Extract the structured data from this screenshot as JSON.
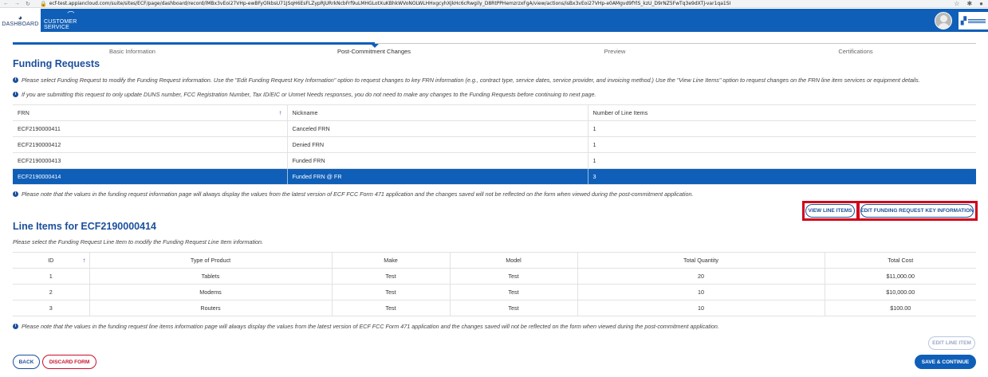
{
  "browser": {
    "url": "ecf-test.appiancloud.com/suite/sites/ECF/page/dashboard/record/lMBx3vEoi27VHp-ewBFyOlkbsU71JSqH6EsFLZypRJURrkNcbFrf9uLMHGLotXuKBhkWVoNOLWLHHxgcyhXJkHc6cRwgily_D8RtPPHemzrzxFgA/view/actions/isBx3vEoi27VHp-e0AMgvd9fYlS_kzU_D9rNZ5FwTq3e9dXTJ-var1qa1SI"
  },
  "header": {
    "tabs": [
      {
        "label": "DASHBOARD",
        "icon": "dashboard-gauge-icon"
      },
      {
        "label": "CUSTOMER SERVICE",
        "icon": "headset-icon"
      }
    ]
  },
  "steps": {
    "labels": [
      "Basic Information",
      "Post-Commitment Changes",
      "Preview",
      "Certifications"
    ],
    "current_index": 1
  },
  "funding": {
    "title": "Funding Requests",
    "info1": "Please select Funding Request to modify the Funding Request information. Use the \"Edit Funding Request Key Information\" option to request changes to key FRN information (e.g., contract type, service dates, service provider, and invoicing method.) Use the \"View Line Items\" option to request changes on the FRN line item services or equipment details.",
    "info2": "If you are submitting this request to only update DUNS number, FCC Registration Number, Tax ID/EIC or Unmet Needs responses, you do not need to make any changes to the Funding Requests before continuing to next page.",
    "columns": [
      "FRN",
      "Nickname",
      "Number of Line Items"
    ],
    "rows": [
      [
        "ECF2190000411",
        "Canceled FRN",
        "1"
      ],
      [
        "ECF2190000412",
        "Denied FRN",
        "1"
      ],
      [
        "ECF2190000413",
        "Funded FRN",
        "1"
      ],
      [
        "ECF2190000414",
        "Funded FRN @ FR",
        "3"
      ]
    ],
    "selected_row": 3,
    "note": "Please note that the values in the funding request information page will always display the values from the latest version of ECF FCC Form 471 application and the changes saved will not be reflected on the form when viewed during the post-commitment application.",
    "view_line_items_label": "VIEW LINE ITEMS",
    "edit_key_info_label": "EDIT FUNDING REQUEST KEY INFORMATION"
  },
  "line_items": {
    "title": "Line Items for ECF2190000414",
    "instruction": "Please select the Funding Request Line Item to modify the Funding Request Line Item information.",
    "columns": [
      "ID",
      "Type of Product",
      "Make",
      "Model",
      "Total Quantity",
      "Total Cost"
    ],
    "rows": [
      [
        "1",
        "Tablets",
        "Test",
        "Test",
        "20",
        "$11,000.00"
      ],
      [
        "2",
        "Modems",
        "Test",
        "Test",
        "10",
        "$10,000.00"
      ],
      [
        "3",
        "Routers",
        "Test",
        "Test",
        "10",
        "$100.00"
      ]
    ],
    "note": "Please note that the values in the funding request line items information page will always display the values from the latest version of ECF FCC Form 471 application and the changes saved will not be reflected on the form when viewed during the post-commitment application.",
    "edit_line_item_label": "EDIT LINE ITEM"
  },
  "footer": {
    "back_label": "BACK",
    "discard_label": "DISCARD FORM",
    "continue_label": "SAVE & CONTINUE"
  },
  "colors": {
    "primary": "#0f5fb8",
    "heading": "#1c4f9c",
    "highlight": "#d0021b",
    "discard": "#c8102e"
  }
}
